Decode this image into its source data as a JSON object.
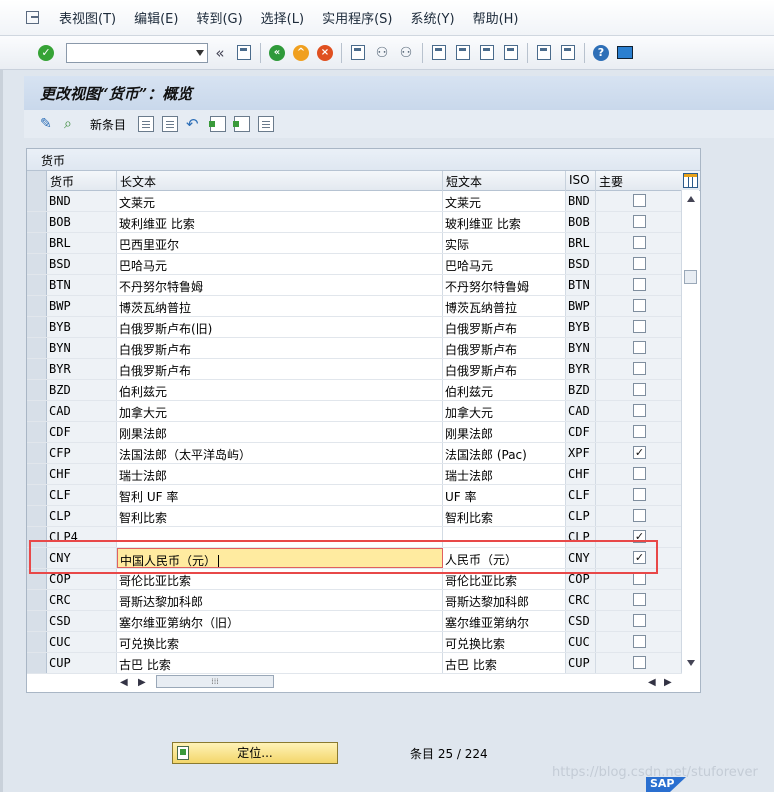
{
  "menubar": {
    "items": [
      "表视图(T)",
      "编辑(E)",
      "转到(G)",
      "选择(L)",
      "实用程序(S)",
      "系统(Y)",
      "帮助(H)"
    ]
  },
  "toolbar": {
    "command_value": "",
    "icons": [
      "enter-icon",
      "back-icon",
      "exit-icon",
      "cancel-icon",
      "print-icon",
      "find-icon",
      "find-next-icon",
      "first-page-icon",
      "prev-page-icon",
      "next-page-icon",
      "last-page-icon",
      "new-session-icon",
      "shortcut-icon",
      "help-icon",
      "customize-layout-icon"
    ]
  },
  "title": "更改视图“货币”：概览",
  "app_toolbar": {
    "new_entries_label": "新条目"
  },
  "table": {
    "caption": "货币",
    "columns": [
      "货币",
      "长文本",
      "短文本",
      "ISO",
      "主要"
    ],
    "rows": [
      {
        "currency": "BND",
        "long": "文莱元",
        "short": "文莱元",
        "iso": "BND",
        "primary": false
      },
      {
        "currency": "BOB",
        "long": "玻利维亚 比索",
        "short": "玻利维亚 比索",
        "iso": "BOB",
        "primary": false
      },
      {
        "currency": "BRL",
        "long": "巴西里亚尔",
        "short": "实际",
        "iso": "BRL",
        "primary": false
      },
      {
        "currency": "BSD",
        "long": "巴哈马元",
        "short": "巴哈马元",
        "iso": "BSD",
        "primary": false
      },
      {
        "currency": "BTN",
        "long": "不丹努尔特鲁姆",
        "short": "不丹努尔特鲁姆",
        "iso": "BTN",
        "primary": false
      },
      {
        "currency": "BWP",
        "long": "博茨瓦纳普拉",
        "short": "博茨瓦纳普拉",
        "iso": "BWP",
        "primary": false
      },
      {
        "currency": "BYB",
        "long": "白俄罗斯卢布(旧)",
        "short": "白俄罗斯卢布",
        "iso": "BYB",
        "primary": false
      },
      {
        "currency": "BYN",
        "long": "白俄罗斯卢布",
        "short": "白俄罗斯卢布",
        "iso": "BYN",
        "primary": false
      },
      {
        "currency": "BYR",
        "long": "白俄罗斯卢布",
        "short": "白俄罗斯卢布",
        "iso": "BYR",
        "primary": false
      },
      {
        "currency": "BZD",
        "long": "伯利兹元",
        "short": "伯利兹元",
        "iso": "BZD",
        "primary": false
      },
      {
        "currency": "CAD",
        "long": "加拿大元",
        "short": "加拿大元",
        "iso": "CAD",
        "primary": false
      },
      {
        "currency": "CDF",
        "long": "刚果法郎",
        "short": "刚果法郎",
        "iso": "CDF",
        "primary": false
      },
      {
        "currency": "CFP",
        "long": "法国法郎（太平洋岛屿）",
        "short": "法国法郎 (Pac)",
        "iso": "XPF",
        "primary": true
      },
      {
        "currency": "CHF",
        "long": "瑞士法郎",
        "short": "瑞士法郎",
        "iso": "CHF",
        "primary": false
      },
      {
        "currency": "CLF",
        "long": "智利 UF 率",
        "short": "UF 率",
        "iso": "CLF",
        "primary": false
      },
      {
        "currency": "CLP",
        "long": "智利比索",
        "short": "智利比索",
        "iso": "CLP",
        "primary": false
      },
      {
        "currency": "CLP4",
        "long": "",
        "short": "",
        "iso": "CLP",
        "primary": true
      },
      {
        "currency": "CNY",
        "long": "中国人民币（元）",
        "short": "人民币（元）",
        "iso": "CNY",
        "primary": true
      },
      {
        "currency": "COP",
        "long": "哥伦比亚比索",
        "short": "哥伦比亚比索",
        "iso": "COP",
        "primary": false
      },
      {
        "currency": "CRC",
        "long": "哥斯达黎加科郎",
        "short": "哥斯达黎加科郎",
        "iso": "CRC",
        "primary": false
      },
      {
        "currency": "CSD",
        "long": "塞尔维亚第纳尔（旧）",
        "short": "塞尔维亚第纳尔",
        "iso": "CSD",
        "primary": false
      },
      {
        "currency": "CUC",
        "long": "可兑换比索",
        "short": "可兑换比索",
        "iso": "CUC",
        "primary": false
      },
      {
        "currency": "CUP",
        "long": "古巴 比索",
        "short": "古巴 比索",
        "iso": "CUP",
        "primary": false
      }
    ]
  },
  "footer": {
    "locate_label": "定位...",
    "entry_info": "条目 25 / 224"
  },
  "watermark": "https://blog.csdn.net/stuforever",
  "brand": "SAP",
  "colors": {
    "title_bg": "#c9d8eb",
    "active_field_bg": "#ffeba0",
    "highlight_border": "#e84848",
    "locate_button_bg": "#f3d66a"
  }
}
